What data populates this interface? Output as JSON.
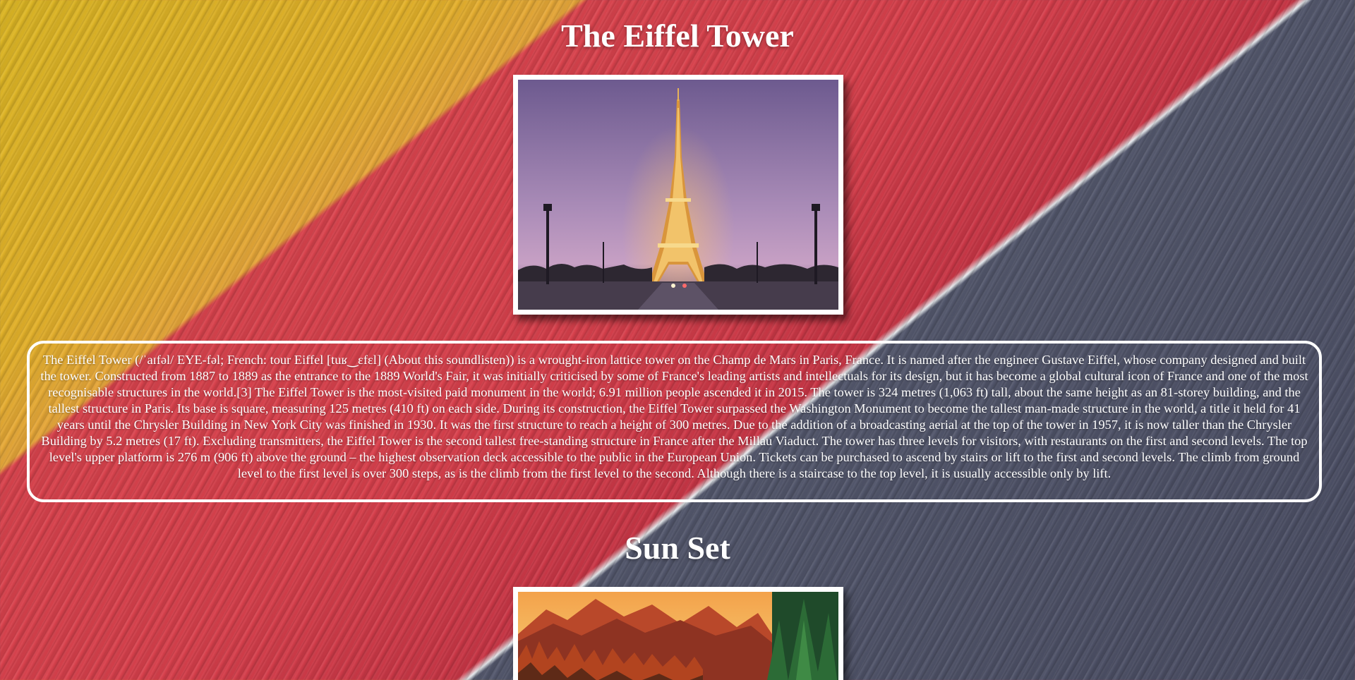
{
  "sections": [
    {
      "title": "The Eiffel Tower",
      "image": "eiffel-tower-at-dusk-photo",
      "description": "The Eiffel Tower (/ˈaɪfəl/ EYE-fəl; French: tour Eiffel [tuʁ‿ɛfɛl] (About this soundlisten)) is a wrought-iron lattice tower on the Champ de Mars in Paris, France. It is named after the engineer Gustave Eiffel, whose company designed and built the tower. Constructed from 1887 to 1889 as the entrance to the 1889 World's Fair, it was initially criticised by some of France's leading artists and intellectuals for its design, but it has become a global cultural icon of France and one of the most recognisable structures in the world.[3] The Eiffel Tower is the most-visited paid monument in the world; 6.91 million people ascended it in 2015. The tower is 324 metres (1,063 ft) tall, about the same height as an 81-storey building, and the tallest structure in Paris. Its base is square, measuring 125 metres (410 ft) on each side. During its construction, the Eiffel Tower surpassed the Washington Monument to become the tallest man-made structure in the world, a title it held for 41 years until the Chrysler Building in New York City was finished in 1930. It was the first structure to reach a height of 300 metres. Due to the addition of a broadcasting aerial at the top of the tower in 1957, it is now taller than the Chrysler Building by 5.2 metres (17 ft). Excluding transmitters, the Eiffel Tower is the second tallest free-standing structure in France after the Millau Viaduct. The tower has three levels for visitors, with restaurants on the first and second levels. The top level's upper platform is 276 m (906 ft) above the ground – the highest observation deck accessible to the public in the European Union. Tickets can be purchased to ascend by stairs or lift to the first and second levels. The climb from ground level to the first level is over 300 steps, as is the climb from the first level to the second. Although there is a staircase to the top level, it is usually accessible only by lift."
    },
    {
      "title": "Sun Set",
      "image": "mountain-sunset-forest-photo"
    }
  ],
  "colors": {
    "stripe_grey": "#53576c",
    "stripe_red": "#d8404c",
    "stripe_yellow": "#e3b12a",
    "text": "#ffffff",
    "frame": "#ffffff"
  }
}
